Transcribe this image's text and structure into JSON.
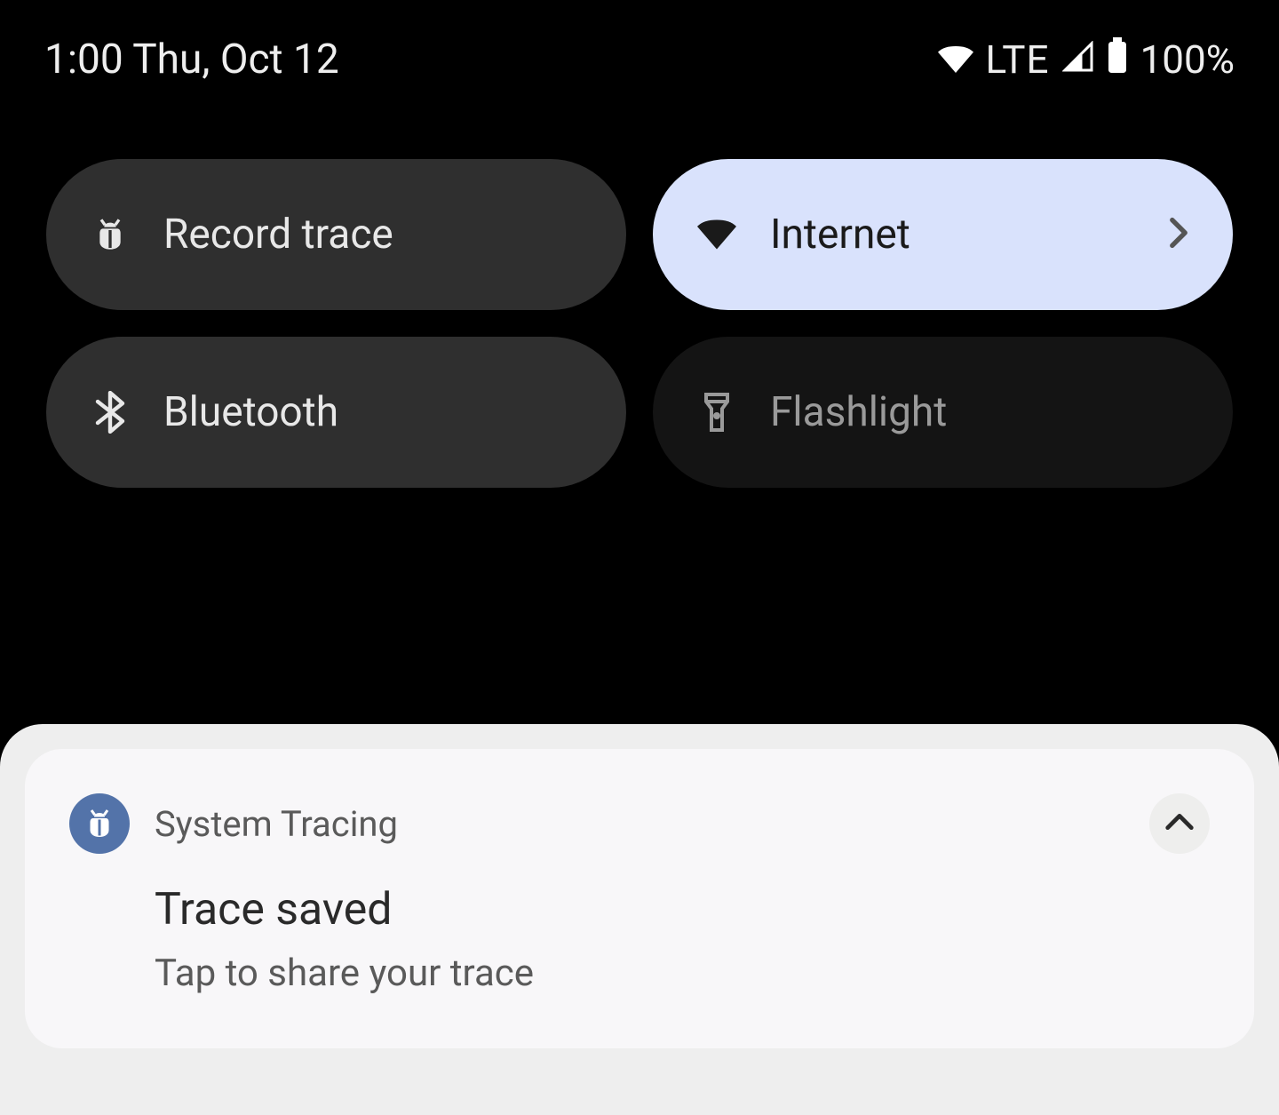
{
  "status_bar": {
    "time_date": "1:00 Thu, Oct 12",
    "network_label": "LTE",
    "battery_pct": "100%"
  },
  "tiles": {
    "record_trace": {
      "label": "Record trace"
    },
    "internet": {
      "label": "Internet"
    },
    "bluetooth": {
      "label": "Bluetooth"
    },
    "flashlight": {
      "label": "Flashlight"
    }
  },
  "notification": {
    "app_name": "System Tracing",
    "title": "Trace saved",
    "body": "Tap to share your trace"
  }
}
